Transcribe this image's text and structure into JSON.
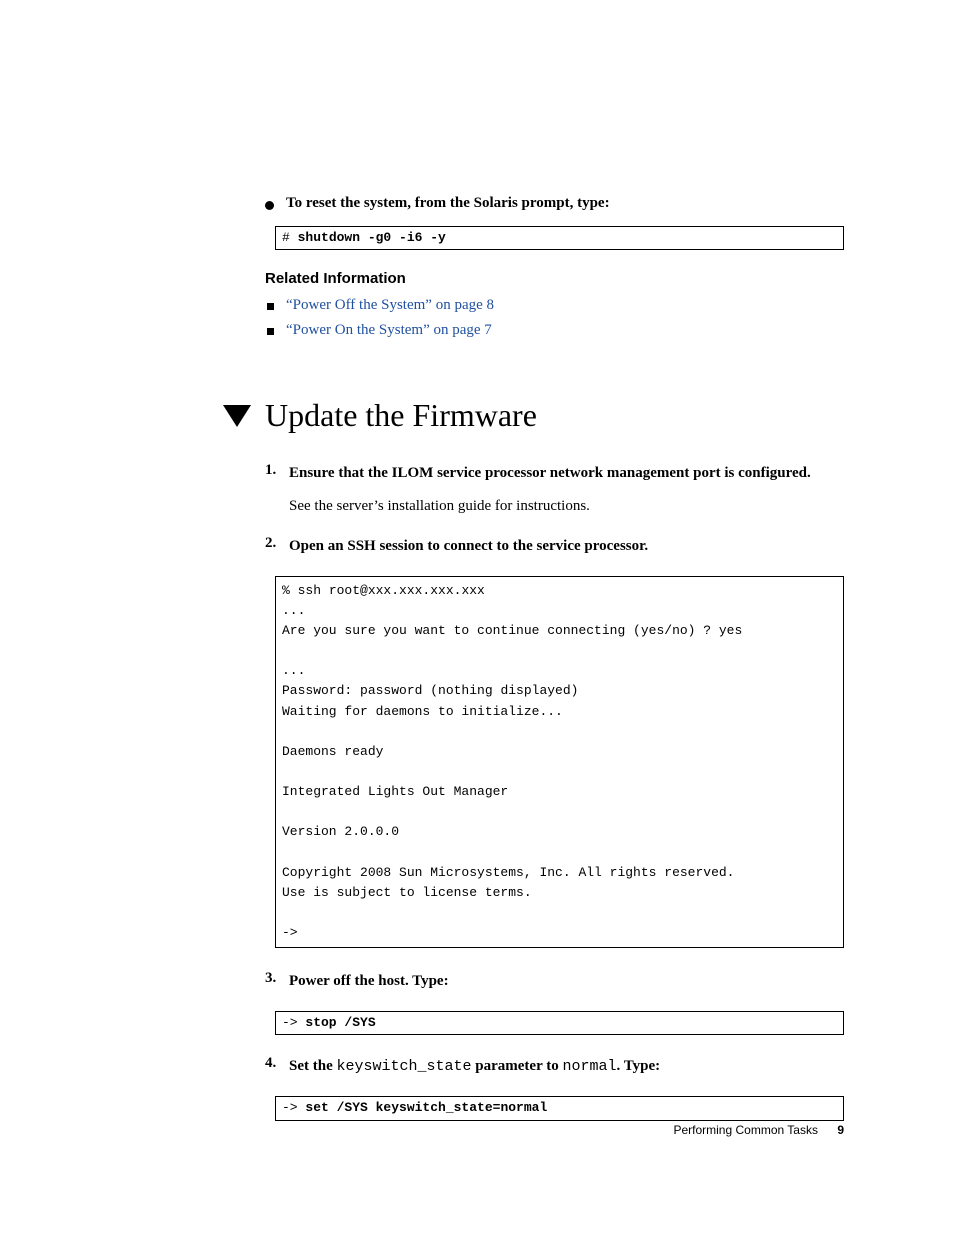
{
  "intro_bullet": "To reset the system, from the Solaris prompt, type:",
  "codebox1": {
    "prompt": "# ",
    "cmd": "shutdown -g0 -i6 -y"
  },
  "related": {
    "heading": "Related Information",
    "items": [
      "“Power Off the System” on page 8",
      "“Power On the System” on page 7"
    ]
  },
  "heading": "Update the Firmware",
  "steps": [
    {
      "num": "1.",
      "text": "Ensure that the ILOM service processor network management port is configured.",
      "sub": "See the server’s installation guide for instructions."
    },
    {
      "num": "2.",
      "text": "Open an SSH session to connect to the service processor."
    },
    {
      "num": "3.",
      "text": "Power off the host. Type:"
    },
    {
      "num": "4.",
      "text_pre": "Set the ",
      "text_mono1": "keyswitch_state",
      "text_mid": " parameter to ",
      "text_mono2": "normal",
      "text_post": ". Type:"
    }
  ],
  "ssh_block": {
    "l1_prompt": "% ",
    "l1_cmd": "ssh",
    "l1_ital": " root@xxx.xxx.xxx.xxx",
    "l2": "...",
    "l3_pre": "Are you sure you want to continue connecting (yes/no) ? ",
    "l3_cmd": "yes",
    "l4": "",
    "l5": "...",
    "l6_pre": "Password: ",
    "l6_ital": "password (nothing displayed)",
    "l7": "Waiting for daemons to initialize...",
    "l8": "",
    "l9": "Daemons ready",
    "l10": "",
    "l11": "Integrated Lights Out Manager",
    "l12": "",
    "l13": "Version 2.0.0.0",
    "l14": "",
    "l15": "Copyright 2008 Sun Microsystems, Inc. All rights reserved.",
    "l16": "Use is subject to license terms.",
    "l17": "",
    "l18": "->"
  },
  "codebox3": {
    "prompt": "-> ",
    "cmd": "stop /SYS"
  },
  "codebox4": {
    "prompt": "-> ",
    "cmd": "set /SYS keyswitch_state=normal"
  },
  "footer": {
    "text": "Performing Common Tasks",
    "page": "9"
  }
}
